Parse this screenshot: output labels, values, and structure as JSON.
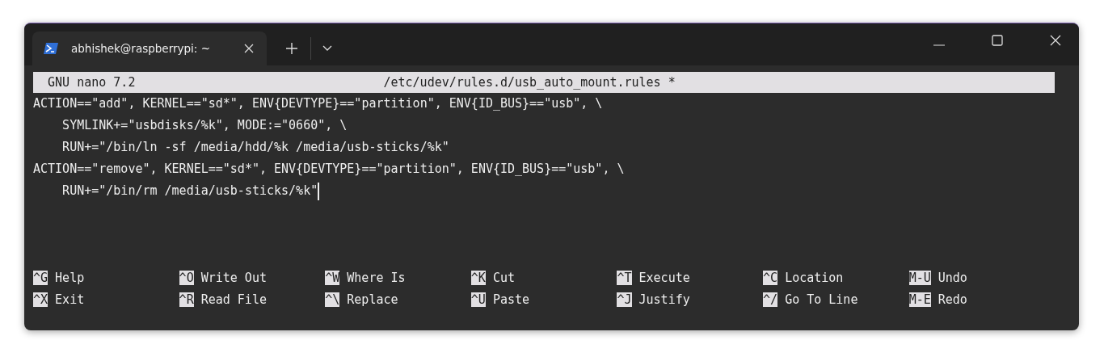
{
  "tab": {
    "title": "abhishek@raspberrypi: ~"
  },
  "nano": {
    "version": "GNU nano 7.2",
    "filename": "/etc/udev/rules.d/usb_auto_mount.rules",
    "modified_mark": "*"
  },
  "lines": [
    "ACTION==\"add\", KERNEL==\"sd*\", ENV{DEVTYPE}==\"partition\", ENV{ID_BUS}==\"usb\", \\",
    "    SYMLINK+=\"usbdisks/%k\", MODE:=\"0660\", \\",
    "    RUN+=\"/bin/ln -sf /media/hdd/%k /media/usb-sticks/%k\"",
    "ACTION==\"remove\", KERNEL==\"sd*\", ENV{DEVTYPE}==\"partition\", ENV{ID_BUS}==\"usb\", \\",
    "    RUN+=\"/bin/rm /media/usb-sticks/%k\""
  ],
  "shortcuts": [
    [
      {
        "key": "^G",
        "label": "Help"
      },
      {
        "key": "^O",
        "label": "Write Out"
      },
      {
        "key": "^W",
        "label": "Where Is"
      },
      {
        "key": "^K",
        "label": "Cut"
      },
      {
        "key": "^T",
        "label": "Execute"
      },
      {
        "key": "^C",
        "label": "Location"
      },
      {
        "key": "M-U",
        "label": "Undo"
      }
    ],
    [
      {
        "key": "^X",
        "label": "Exit"
      },
      {
        "key": "^R",
        "label": "Read File"
      },
      {
        "key": "^\\",
        "label": "Replace"
      },
      {
        "key": "^U",
        "label": "Paste"
      },
      {
        "key": "^J",
        "label": "Justify"
      },
      {
        "key": "^/",
        "label": "Go To Line"
      },
      {
        "key": "M-E",
        "label": "Redo"
      }
    ]
  ]
}
